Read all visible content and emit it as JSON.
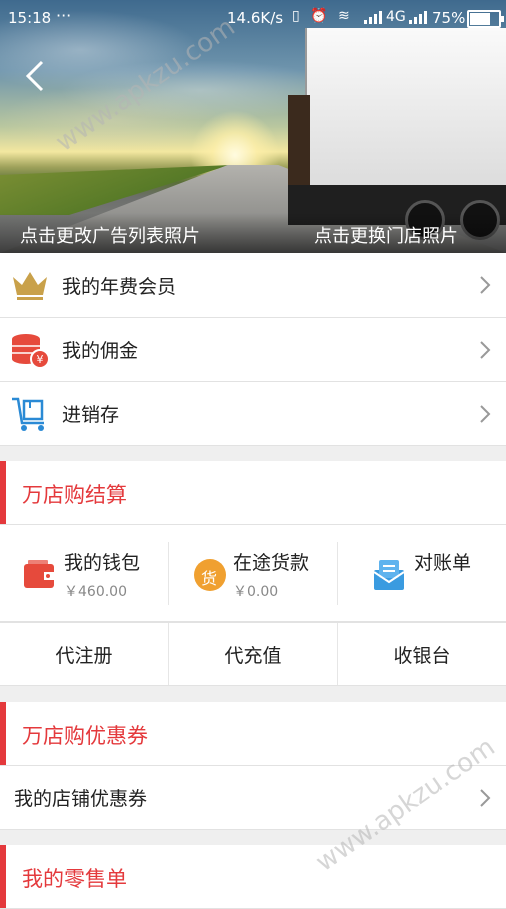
{
  "status_bar": {
    "time": "15:18",
    "dots": "···",
    "speed": "14.6K/s",
    "network": "4G",
    "battery": "75%"
  },
  "hero": {
    "left_link": "点击更改广告列表照片",
    "right_link": "点击更换门店照片"
  },
  "menu": [
    {
      "label": "我的年费会员",
      "icon": "crown-icon"
    },
    {
      "label": "我的佣金",
      "icon": "coins-icon"
    },
    {
      "label": "进销存",
      "icon": "cart-icon"
    }
  ],
  "settlement": {
    "title": "万店购结算",
    "wallet": {
      "label": "我的钱包",
      "amount": "￥460.00"
    },
    "transit": {
      "label": "在途货款",
      "amount": "￥0.00",
      "badge": "货"
    },
    "statement": {
      "label": "对账单"
    },
    "actions": [
      "代注册",
      "代充值",
      "收银台"
    ]
  },
  "coupon": {
    "title": "万店购优惠券",
    "item": "我的店铺优惠券"
  },
  "retail": {
    "title": "我的零售单"
  },
  "watermark": "www.apkzu.com",
  "colors": {
    "accent": "#e4393c",
    "crown": "#c9a14a",
    "coin": "#e64a3c",
    "cart": "#2a8ad5",
    "badge": "#f0a030",
    "statement": "#3a9be0"
  }
}
